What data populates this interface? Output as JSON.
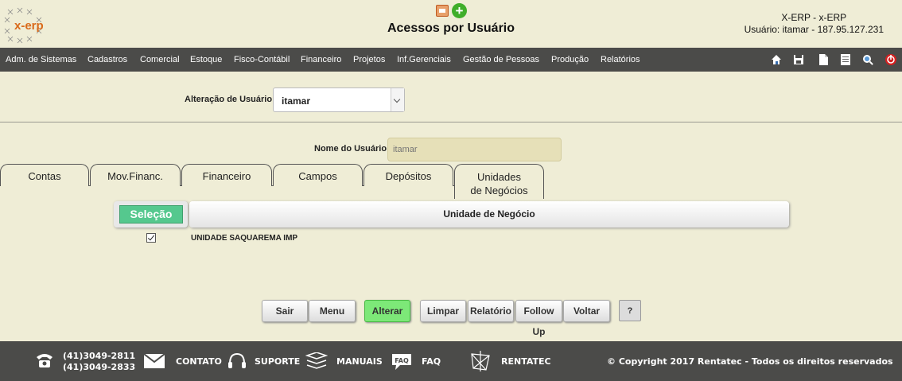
{
  "header": {
    "logo_text": "x-erp",
    "title": "Acessos por Usuário",
    "system_name": "X-ERP - x-ERP",
    "user_line": "Usuário: itamar - 187.95.127.231"
  },
  "menu": {
    "items": [
      "Adm. de Sistemas",
      "Cadastros",
      "Comercial",
      "Estoque",
      "Fisco-Contábil",
      "Financeiro",
      "Projetos",
      "Inf.Gerenciais",
      "Gestão de Pessoas",
      "Produção",
      "Relatórios"
    ],
    "tool_icons": [
      "home-icon",
      "save-icon",
      "document-icon",
      "notes-icon",
      "search-icon",
      "logout-icon"
    ]
  },
  "form": {
    "alteracao_label": "Alteração de Usuário:",
    "selected_user": "itamar",
    "nome_label": "Nome do Usuário",
    "nome_value": "itamar"
  },
  "tabs": [
    {
      "label": "Contas"
    },
    {
      "label": "Mov.Financ."
    },
    {
      "label": "Financeiro"
    },
    {
      "label": "Campos"
    },
    {
      "label": "Depósitos"
    },
    {
      "label_line1": "Unidades",
      "label_line2": "de Negócios",
      "active": true
    }
  ],
  "table": {
    "selecao_label": "Seleção",
    "header": "Unidade de Negócio",
    "rows": [
      {
        "checked": true,
        "name": "UNIDADE SAQUAREMA IMP"
      }
    ]
  },
  "actions": [
    "Sair",
    "Menu",
    "Alterar",
    "Limpar",
    "Relatório",
    "Follow Up",
    "Voltar",
    "?"
  ],
  "footer": {
    "phone1": "(41)3049-2811",
    "phone2": "(41)3049-2833",
    "contato": "CONTATO",
    "suporte": "SUPORTE",
    "manuais": "MANUAIS",
    "faq": "FAQ",
    "faq_icon_text": "FAQ",
    "rentatec": "RENTATEC",
    "copyright": "© Copyright 2017 Rentatec - Todos os direitos reservados"
  },
  "colors": {
    "background": "#efedd6",
    "bar": "#4b4b49",
    "selecao": "#55c88e",
    "alterar": "#7de878"
  }
}
